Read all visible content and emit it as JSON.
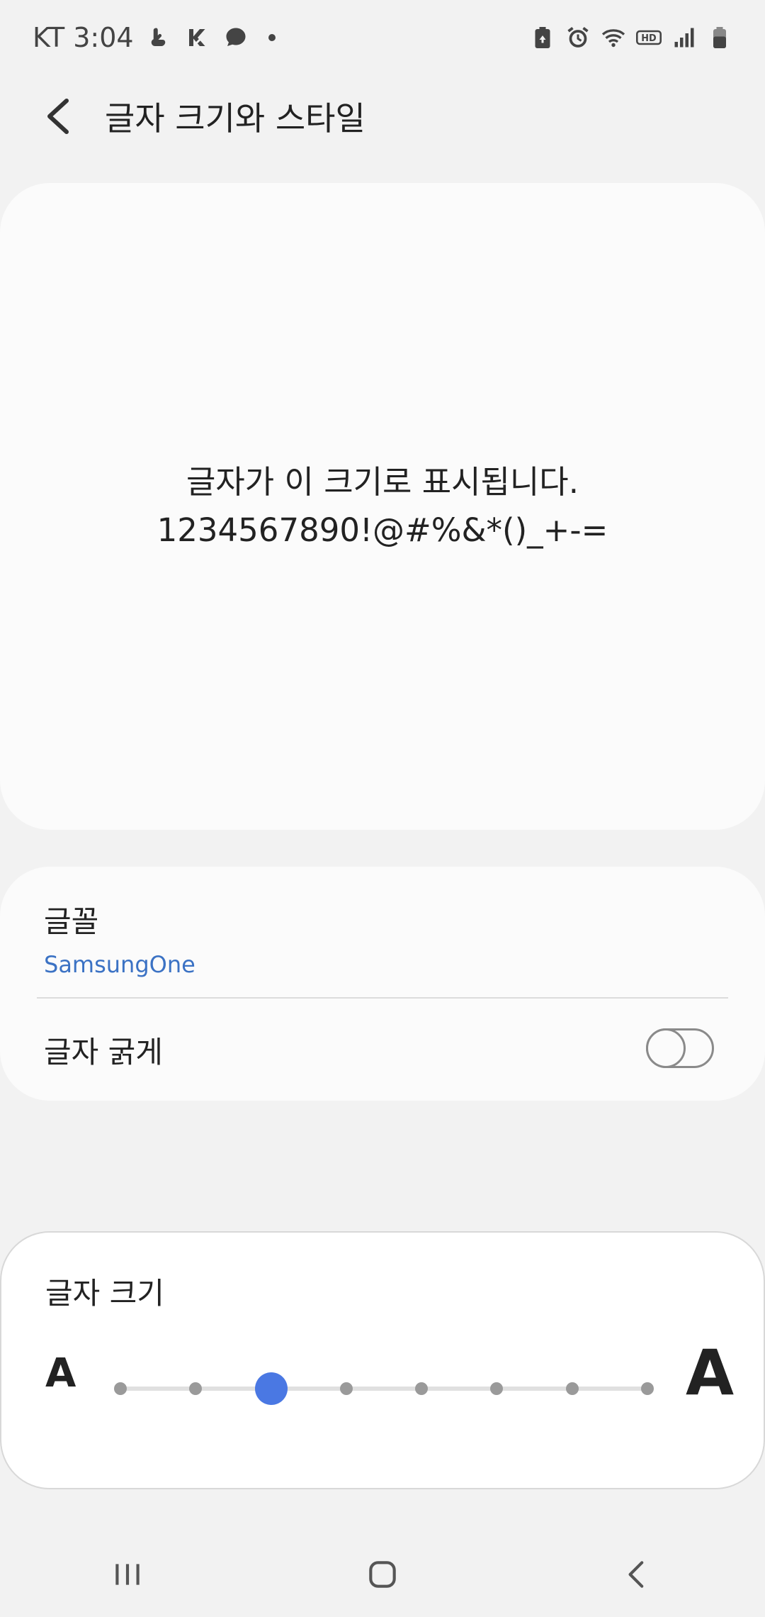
{
  "status_bar": {
    "carrier_time": "KT 3:04",
    "left_icons": [
      "hand-icon",
      "stylized-k-icon",
      "chat-bubble-icon"
    ],
    "right_icons": [
      "battery-saver-icon",
      "alarm-icon",
      "wifi-icon",
      "hd-voice-icon",
      "signal-icon",
      "battery-icon"
    ]
  },
  "header": {
    "title": "글자 크기와 스타일",
    "back_icon": "chevron-left-icon"
  },
  "preview": {
    "line1": "글자가 이 크기로 표시됩니다.",
    "line2": "1234567890!@#%&*()_+-="
  },
  "settings": {
    "font_label": "글꼴",
    "font_value": "SamsungOne",
    "bold_label": "글자 굵게",
    "bold_enabled": false
  },
  "text_size": {
    "label": "글자 크기",
    "small_glyph": "A",
    "large_glyph": "A",
    "steps": 8,
    "selected_index": 2,
    "accent_color": "#4a78e3"
  },
  "nav_bar": {
    "icons": [
      "recent-apps-icon",
      "home-icon",
      "back-icon"
    ]
  }
}
